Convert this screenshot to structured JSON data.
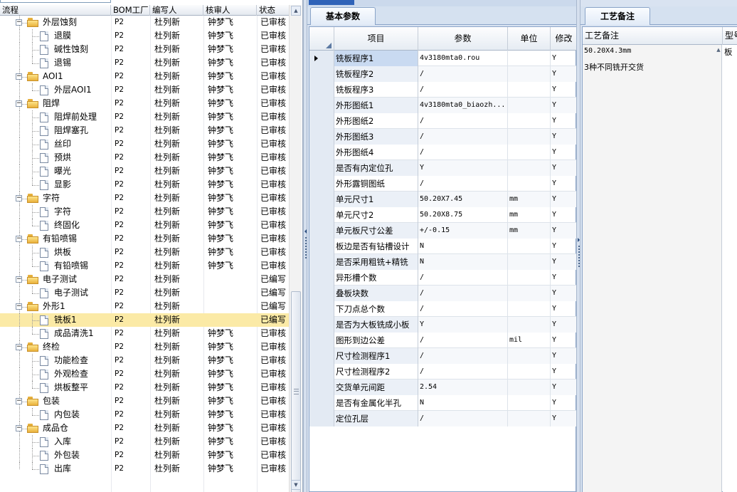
{
  "tree": {
    "columns": [
      "流程",
      "BOM工厂",
      "编写人",
      "核审人",
      "状态"
    ],
    "rows": [
      {
        "type": "folder",
        "name": "外层蚀刻",
        "bom": "P2",
        "writer": "杜列新",
        "reviewer": "钟梦飞",
        "status": "已审核"
      },
      {
        "type": "leaf",
        "name": "退膜",
        "bom": "P2",
        "writer": "杜列新",
        "reviewer": "钟梦飞",
        "status": "已审核"
      },
      {
        "type": "leaf",
        "name": "碱性蚀刻",
        "bom": "P2",
        "writer": "杜列新",
        "reviewer": "钟梦飞",
        "status": "已审核"
      },
      {
        "type": "leaf",
        "name": "退锡",
        "bom": "P2",
        "writer": "杜列新",
        "reviewer": "钟梦飞",
        "status": "已审核"
      },
      {
        "type": "folder",
        "name": "AOI1",
        "bom": "P2",
        "writer": "杜列新",
        "reviewer": "钟梦飞",
        "status": "已审核"
      },
      {
        "type": "leaf",
        "name": "外层AOI1",
        "bom": "P2",
        "writer": "杜列新",
        "reviewer": "钟梦飞",
        "status": "已审核"
      },
      {
        "type": "folder",
        "name": "阻焊",
        "bom": "P2",
        "writer": "杜列新",
        "reviewer": "钟梦飞",
        "status": "已审核"
      },
      {
        "type": "leaf",
        "name": "阻焊前处理",
        "bom": "P2",
        "writer": "杜列新",
        "reviewer": "钟梦飞",
        "status": "已审核"
      },
      {
        "type": "leaf",
        "name": "阻焊塞孔",
        "bom": "P2",
        "writer": "杜列新",
        "reviewer": "钟梦飞",
        "status": "已审核"
      },
      {
        "type": "leaf",
        "name": "丝印",
        "bom": "P2",
        "writer": "杜列新",
        "reviewer": "钟梦飞",
        "status": "已审核"
      },
      {
        "type": "leaf",
        "name": "预烘",
        "bom": "P2",
        "writer": "杜列新",
        "reviewer": "钟梦飞",
        "status": "已审核"
      },
      {
        "type": "leaf",
        "name": "曝光",
        "bom": "P2",
        "writer": "杜列新",
        "reviewer": "钟梦飞",
        "status": "已审核"
      },
      {
        "type": "leaf",
        "name": "显影",
        "bom": "P2",
        "writer": "杜列新",
        "reviewer": "钟梦飞",
        "status": "已审核"
      },
      {
        "type": "folder",
        "name": "字符",
        "bom": "P2",
        "writer": "杜列新",
        "reviewer": "钟梦飞",
        "status": "已审核"
      },
      {
        "type": "leaf",
        "name": "字符",
        "bom": "P2",
        "writer": "杜列新",
        "reviewer": "钟梦飞",
        "status": "已审核"
      },
      {
        "type": "leaf",
        "name": "终固化",
        "bom": "P2",
        "writer": "杜列新",
        "reviewer": "钟梦飞",
        "status": "已审核"
      },
      {
        "type": "folder",
        "name": "有铅喷锡",
        "bom": "P2",
        "writer": "杜列新",
        "reviewer": "钟梦飞",
        "status": "已审核"
      },
      {
        "type": "leaf",
        "name": "烘板",
        "bom": "P2",
        "writer": "杜列新",
        "reviewer": "钟梦飞",
        "status": "已审核"
      },
      {
        "type": "leaf",
        "name": "有铅喷锡",
        "bom": "P2",
        "writer": "杜列新",
        "reviewer": "钟梦飞",
        "status": "已审核"
      },
      {
        "type": "folder",
        "name": "电子测试",
        "bom": "P2",
        "writer": "杜列新",
        "reviewer": "",
        "status": "已编写"
      },
      {
        "type": "leaf",
        "name": "电子测试",
        "bom": "P2",
        "writer": "杜列新",
        "reviewer": "",
        "status": "已编写"
      },
      {
        "type": "folder",
        "name": "外形1",
        "bom": "P2",
        "writer": "杜列新",
        "reviewer": "",
        "status": "已编写"
      },
      {
        "type": "leaf",
        "name": "铣板1",
        "bom": "P2",
        "writer": "杜列新",
        "reviewer": "",
        "status": "已编写",
        "selected": true
      },
      {
        "type": "leaf",
        "name": "成品清洗1",
        "bom": "P2",
        "writer": "杜列新",
        "reviewer": "钟梦飞",
        "status": "已审核"
      },
      {
        "type": "folder",
        "name": "终检",
        "bom": "P2",
        "writer": "杜列新",
        "reviewer": "钟梦飞",
        "status": "已审核"
      },
      {
        "type": "leaf",
        "name": "功能检查",
        "bom": "P2",
        "writer": "杜列新",
        "reviewer": "钟梦飞",
        "status": "已审核"
      },
      {
        "type": "leaf",
        "name": "外观检查",
        "bom": "P2",
        "writer": "杜列新",
        "reviewer": "钟梦飞",
        "status": "已审核"
      },
      {
        "type": "leaf",
        "name": "烘板整平",
        "bom": "P2",
        "writer": "杜列新",
        "reviewer": "钟梦飞",
        "status": "已审核"
      },
      {
        "type": "folder",
        "name": "包装",
        "bom": "P2",
        "writer": "杜列新",
        "reviewer": "钟梦飞",
        "status": "已审核"
      },
      {
        "type": "leaf",
        "name": "内包装",
        "bom": "P2",
        "writer": "杜列新",
        "reviewer": "钟梦飞",
        "status": "已审核"
      },
      {
        "type": "folder",
        "name": "成品仓",
        "bom": "P2",
        "writer": "杜列新",
        "reviewer": "钟梦飞",
        "status": "已审核"
      },
      {
        "type": "leaf",
        "name": "入库",
        "bom": "P2",
        "writer": "杜列新",
        "reviewer": "钟梦飞",
        "status": "已审核"
      },
      {
        "type": "leaf",
        "name": "外包装",
        "bom": "P2",
        "writer": "杜列新",
        "reviewer": "钟梦飞",
        "status": "已审核"
      },
      {
        "type": "leaf",
        "name": "出库",
        "bom": "P2",
        "writer": "杜列新",
        "reviewer": "钟梦飞",
        "status": "已审核"
      }
    ]
  },
  "params": {
    "tab_label": "基本参数",
    "columns": [
      "项目",
      "参数",
      "单位",
      "修改"
    ],
    "rows": [
      {
        "item": "铣板程序1",
        "value": "4v3180mta0.rou",
        "unit": "",
        "mod": "Y"
      },
      {
        "item": "铣板程序2",
        "value": "/",
        "unit": "",
        "mod": "Y"
      },
      {
        "item": "铣板程序3",
        "value": "/",
        "unit": "",
        "mod": "Y"
      },
      {
        "item": "外形图纸1",
        "value": "4v3180mta0_biaozh...",
        "unit": "",
        "mod": "Y"
      },
      {
        "item": "外形图纸2",
        "value": "/",
        "unit": "",
        "mod": "Y"
      },
      {
        "item": "外形图纸3",
        "value": "/",
        "unit": "",
        "mod": "Y"
      },
      {
        "item": "外形图纸4",
        "value": "/",
        "unit": "",
        "mod": "Y"
      },
      {
        "item": "是否有内定位孔",
        "value": "Y",
        "unit": "",
        "mod": "Y"
      },
      {
        "item": "外形露铜图纸",
        "value": "/",
        "unit": "",
        "mod": "Y"
      },
      {
        "item": "单元尺寸1",
        "value": "50.20X7.45",
        "unit": "mm",
        "mod": "Y"
      },
      {
        "item": "单元尺寸2",
        "value": "50.20X8.75",
        "unit": "mm",
        "mod": "Y"
      },
      {
        "item": "单元板尺寸公差",
        "value": "+/-0.15",
        "unit": "mm",
        "mod": "Y"
      },
      {
        "item": "板边是否有钻槽设计",
        "value": "N",
        "unit": "",
        "mod": "Y"
      },
      {
        "item": "是否采用粗铣+精铣",
        "value": "N",
        "unit": "",
        "mod": "Y"
      },
      {
        "item": "异形槽个数",
        "value": "/",
        "unit": "",
        "mod": "Y"
      },
      {
        "item": "叠板块数",
        "value": "/",
        "unit": "",
        "mod": "Y"
      },
      {
        "item": "下刀点总个数",
        "value": "/",
        "unit": "",
        "mod": "Y"
      },
      {
        "item": "是否为大板铣成小板",
        "value": "Y",
        "unit": "",
        "mod": "Y"
      },
      {
        "item": "图形到边公差",
        "value": "/",
        "unit": "mil",
        "mod": "Y"
      },
      {
        "item": "尺寸检测程序1",
        "value": "/",
        "unit": "",
        "mod": "Y"
      },
      {
        "item": "尺寸检测程序2",
        "value": "/",
        "unit": "",
        "mod": "Y"
      },
      {
        "item": "交货单元间距",
        "value": "2.54",
        "unit": "",
        "mod": "Y"
      },
      {
        "item": "是否有金属化半孔",
        "value": "N",
        "unit": "",
        "mod": "Y"
      },
      {
        "item": "定位孔层",
        "value": "/",
        "unit": "",
        "mod": "Y"
      }
    ]
  },
  "notes": {
    "tab_label": "工艺备注",
    "col_note": "工艺备注",
    "col_type": "型号",
    "note_line1": "50.20X4.3mm",
    "note_line2": "3种不同铣开交货",
    "type_value": "板"
  },
  "colors": {
    "selected_row": "#fbeaa6",
    "panel_bg": "#d9e3f1",
    "folder": "#e9b13b"
  }
}
